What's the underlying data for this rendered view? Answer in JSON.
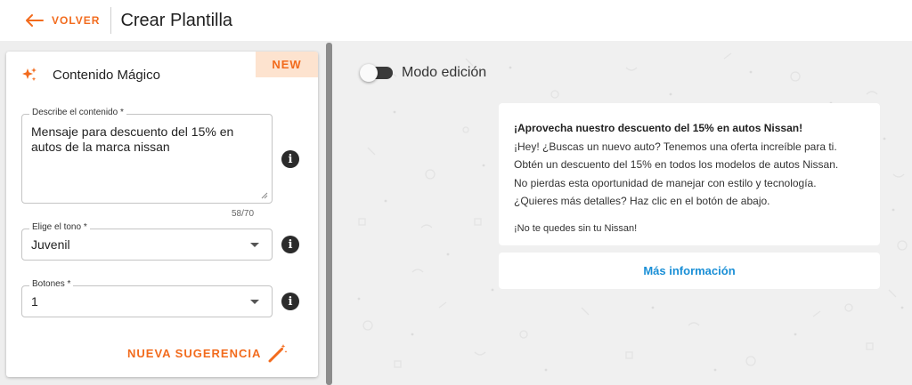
{
  "header": {
    "back_label": "VOLVER",
    "title": "Crear Plantilla"
  },
  "magic": {
    "badge": "NEW",
    "title": "Contenido Mágico",
    "description": {
      "label": "Describe el contenido *",
      "value": "Mensaje para descuento del 15% en autos de la marca nissan",
      "counter": "58/70"
    },
    "tone": {
      "label": "Elige el tono *",
      "value": "Juvenil"
    },
    "buttons": {
      "label": "Botones *",
      "value": "1"
    },
    "suggest_label": "NUEVA SUGERENCIA"
  },
  "preview": {
    "edit_mode_label": "Modo edición",
    "message": {
      "title": "¡Aprovecha nuestro descuento del 15% en autos Nissan!",
      "lines": [
        "¡Hey! ¿Buscas un nuevo auto? Tenemos una oferta increíble para ti.",
        "Obtén un descuento del 15% en todos los modelos de autos Nissan.",
        "No pierdas esta oportunidad de manejar con estilo y tecnología.",
        "¿Quieres más detalles? Haz clic en el botón de abajo."
      ],
      "footer": "¡No te quedes sin tu Nissan!"
    },
    "button_label": "Más información"
  },
  "icons": {
    "back": "arrow-left-icon",
    "magic": "sparkles-icon",
    "info": "info-icon",
    "wand": "magic-wand-icon"
  },
  "colors": {
    "accent": "#f26b1d",
    "badge_bg": "#fde3cf",
    "link": "#1a8fd6"
  }
}
